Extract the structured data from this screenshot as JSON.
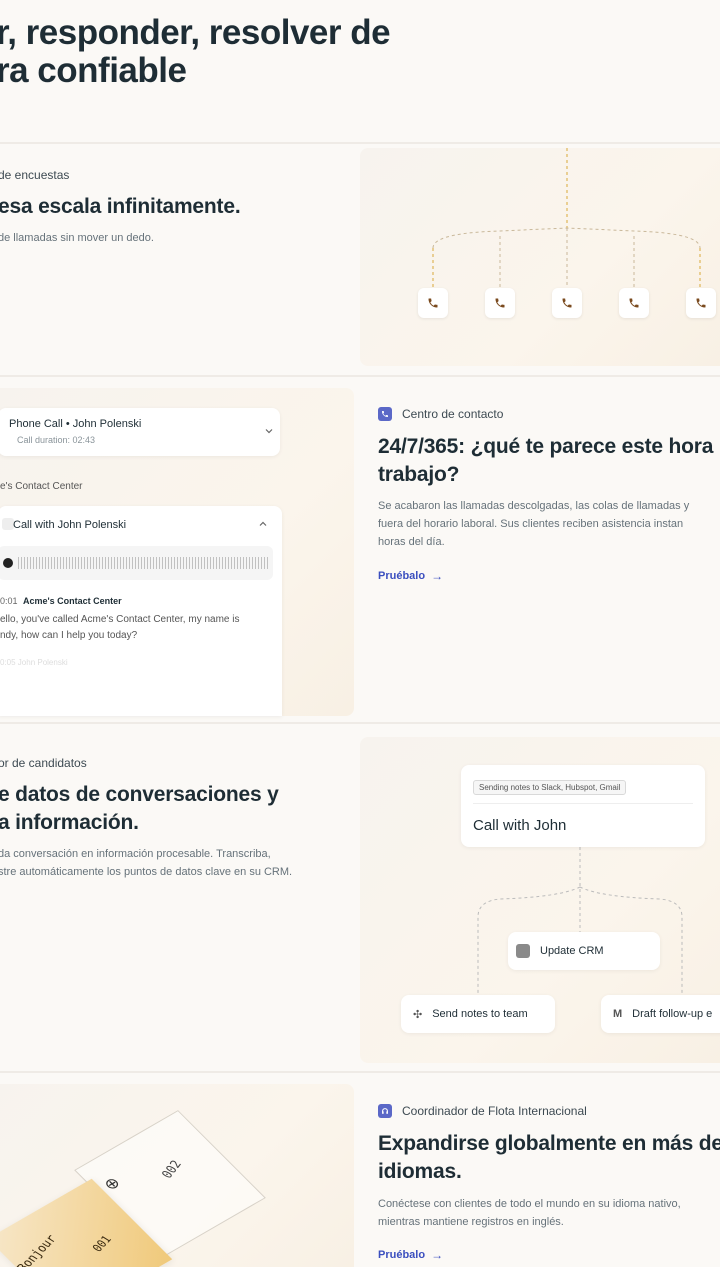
{
  "hero": {
    "line1": "r, responder, resolver de",
    "line2": "ra confiable"
  },
  "section1": {
    "category": "de encuestas",
    "title": "esa escala infinitamente.",
    "desc": "de llamadas sin mover un dedo.",
    "phone_count": 5
  },
  "section2": {
    "call_header_title": "Phone Call • John Polenski",
    "call_duration": "Call duration: 02:43",
    "center_label": "e's Contact Center",
    "call_with": "Call with John Polenski",
    "transcript_time": "0:01",
    "transcript_speaker": "Acme's Contact Center",
    "transcript_line1": "ello, you've called Acme's Contact Center, my name is",
    "transcript_line2": "ndy, how can I help you today?",
    "transcript_faded": "0:05  John Polenski",
    "category": "Centro de contacto",
    "title_line1": "24/7/365: ¿qué te parece este hora",
    "title_line2": "trabajo?",
    "desc_line1": "Se acabaron las llamadas descolgadas, las colas de llamadas y",
    "desc_line2": "fuera del horario laboral. Sus clientes reciben asistencia instan",
    "desc_line3": "horas del día.",
    "link": "Pruébalo"
  },
  "section3": {
    "category": "or de candidatos",
    "title_line1": "e datos de conversaciones y",
    "title_line2": "a información.",
    "desc_line1": "da conversación en información procesable. Transcriba,",
    "desc_line2": "stre automáticamente los puntos de datos clave en su CRM.",
    "chip": "Sending notes to Slack, Hubspot, Gmail",
    "card_title": "Call with John",
    "update_crm": "Update CRM",
    "send_notes": "Send notes to team",
    "draft": "Draft follow-up e"
  },
  "section4": {
    "card_bonjour": "Bonjour",
    "card_001": "001",
    "card_002": "002",
    "category": "Coordinador de Flota Internacional",
    "title_line1": "Expandirse globalmente en más de",
    "title_line2": "idiomas.",
    "desc_line1": "Conéctese con clientes de todo el mundo en su idioma nativo,",
    "desc_line2": "mientras mantiene registros en inglés.",
    "link": "Pruébalo"
  },
  "colors": {
    "accent": "#3b4fbf",
    "badge": "#5b68c7",
    "phone": "#7a4a1e",
    "connector": "#d9a93a"
  }
}
